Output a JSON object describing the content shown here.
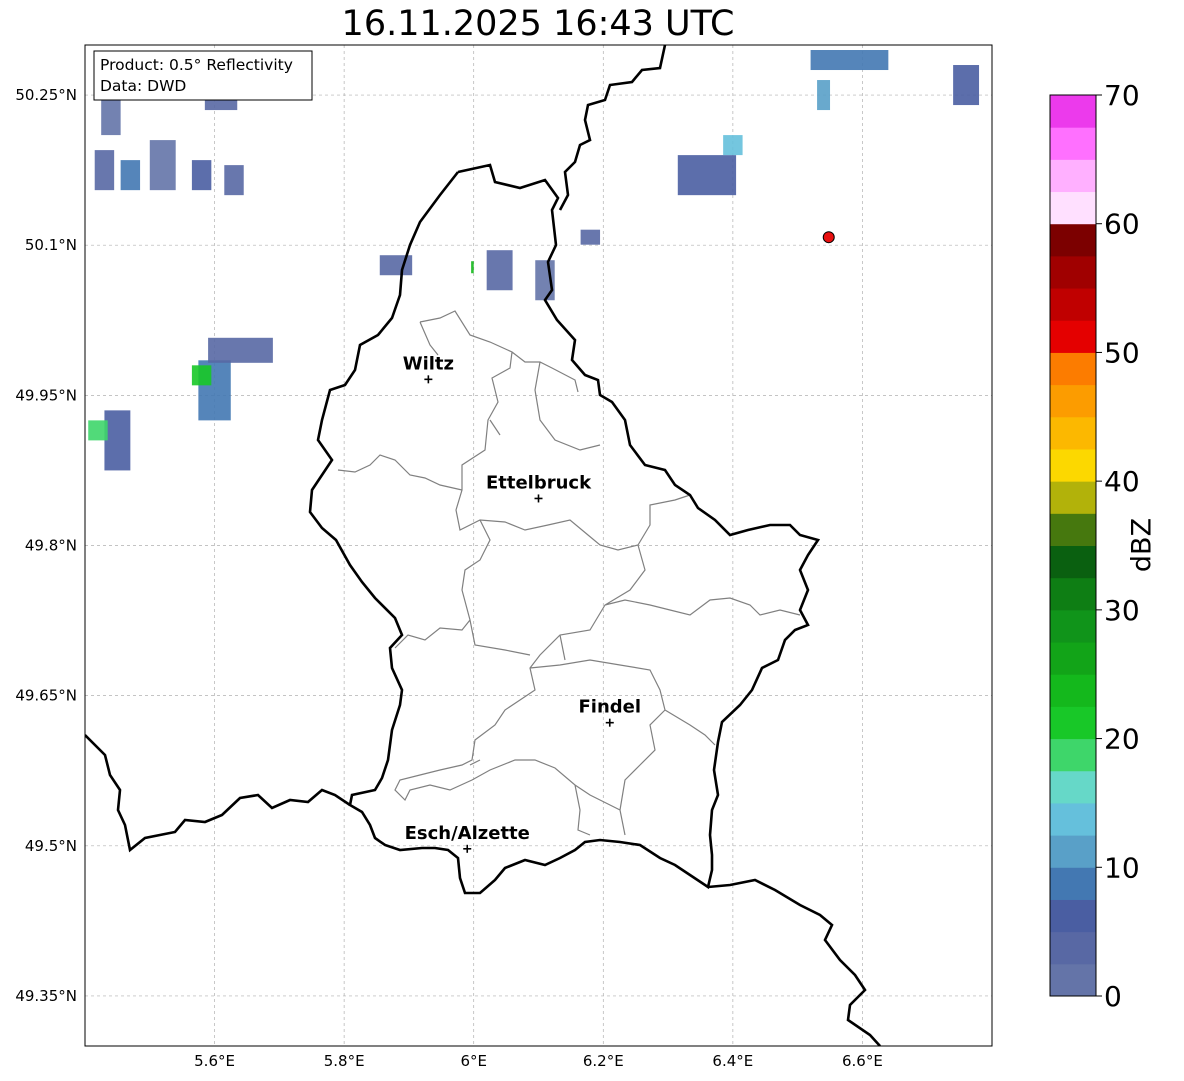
{
  "title": "16.11.2025 16:43 UTC",
  "info_box": {
    "product": "Product: 0.5° Reflectivity",
    "data": "Data: DWD"
  },
  "map": {
    "lon_range": [
      5.4,
      6.8
    ],
    "lat_range": [
      49.3,
      50.3
    ],
    "lon_ticks": [
      {
        "value": 5.6,
        "label": "5.6°E"
      },
      {
        "value": 5.8,
        "label": "5.8°E"
      },
      {
        "value": 6.0,
        "label": "6°E"
      },
      {
        "value": 6.2,
        "label": "6.2°E"
      },
      {
        "value": 6.4,
        "label": "6.4°E"
      },
      {
        "value": 6.6,
        "label": "6.6°E"
      }
    ],
    "lat_ticks": [
      {
        "value": 50.25,
        "label": "50.25°N"
      },
      {
        "value": 50.1,
        "label": "50.1°N"
      },
      {
        "value": 49.95,
        "label": "49.95°N"
      },
      {
        "value": 49.8,
        "label": "49.8°N"
      },
      {
        "value": 49.65,
        "label": "49.65°N"
      },
      {
        "value": 49.5,
        "label": "49.5°N"
      },
      {
        "value": 49.35,
        "label": "49.35°N"
      }
    ],
    "cities": [
      {
        "name": "Wiltz",
        "lon": 5.93,
        "lat": 49.966
      },
      {
        "name": "Ettelbruck",
        "lon": 6.1,
        "lat": 49.847
      },
      {
        "name": "Findel",
        "lon": 6.21,
        "lat": 49.623
      },
      {
        "name": "Esch/Alzette",
        "lon": 5.99,
        "lat": 49.497
      }
    ],
    "radar_site": {
      "lon": 6.548,
      "lat": 50.108,
      "color": "#e81010"
    },
    "echoes": [
      {
        "lon": 5.43,
        "lat": 50.175,
        "w": 0.03,
        "h": 0.04,
        "dbz": 3
      },
      {
        "lon": 5.47,
        "lat": 50.17,
        "w": 0.03,
        "h": 0.03,
        "dbz": 8
      },
      {
        "lon": 5.52,
        "lat": 50.18,
        "w": 0.04,
        "h": 0.05,
        "dbz": 2
      },
      {
        "lon": 5.58,
        "lat": 50.17,
        "w": 0.03,
        "h": 0.03,
        "dbz": 5
      },
      {
        "lon": 5.63,
        "lat": 50.165,
        "w": 0.03,
        "h": 0.03,
        "dbz": 3
      },
      {
        "lon": 5.61,
        "lat": 50.25,
        "w": 0.05,
        "h": 0.03,
        "dbz": 4
      },
      {
        "lon": 5.44,
        "lat": 50.24,
        "w": 0.03,
        "h": 0.06,
        "dbz": 2
      },
      {
        "lon": 5.6,
        "lat": 49.955,
        "w": 0.05,
        "h": 0.06,
        "dbz": 9
      },
      {
        "lon": 5.58,
        "lat": 49.97,
        "w": 0.03,
        "h": 0.02,
        "dbz": 22
      },
      {
        "lon": 5.64,
        "lat": 49.995,
        "w": 0.1,
        "h": 0.025,
        "dbz": 3
      },
      {
        "lon": 5.45,
        "lat": 49.905,
        "w": 0.04,
        "h": 0.06,
        "dbz": 7
      },
      {
        "lon": 5.42,
        "lat": 49.915,
        "w": 0.03,
        "h": 0.02,
        "dbz": 19
      },
      {
        "lon": 5.88,
        "lat": 50.08,
        "w": 0.05,
        "h": 0.02,
        "dbz": 3
      },
      {
        "lon": 6.04,
        "lat": 50.075,
        "w": 0.04,
        "h": 0.04,
        "dbz": 4
      },
      {
        "lon": 5.998,
        "lat": 50.078,
        "w": 0.004,
        "h": 0.012,
        "dbz": 24
      },
      {
        "lon": 6.11,
        "lat": 50.065,
        "w": 0.03,
        "h": 0.04,
        "dbz": 2
      },
      {
        "lon": 6.18,
        "lat": 50.108,
        "w": 0.03,
        "h": 0.015,
        "dbz": 3
      },
      {
        "lon": 6.36,
        "lat": 50.17,
        "w": 0.09,
        "h": 0.04,
        "dbz": 6
      },
      {
        "lon": 6.4,
        "lat": 50.2,
        "w": 0.03,
        "h": 0.02,
        "dbz": 14
      },
      {
        "lon": 6.58,
        "lat": 50.285,
        "w": 0.12,
        "h": 0.02,
        "dbz": 8
      },
      {
        "lon": 6.54,
        "lat": 50.25,
        "w": 0.02,
        "h": 0.03,
        "dbz": 12
      },
      {
        "lon": 6.76,
        "lat": 50.26,
        "w": 0.04,
        "h": 0.04,
        "dbz": 5
      }
    ],
    "colors": {
      "border": "#000000",
      "canton": "#808080",
      "grid": "#b0b0b0"
    }
  },
  "colorbar": {
    "label": "dBZ",
    "min": 0,
    "max": 70,
    "ticks": [
      {
        "value": 0,
        "label": "0"
      },
      {
        "value": 10,
        "label": "10"
      },
      {
        "value": 20,
        "label": "20"
      },
      {
        "value": 30,
        "label": "30"
      },
      {
        "value": 40,
        "label": "40"
      },
      {
        "value": 50,
        "label": "50"
      },
      {
        "value": 60,
        "label": "60"
      },
      {
        "value": 70,
        "label": "70"
      }
    ],
    "colors": [
      "#6474a8",
      "#5868a4",
      "#4a5ea2",
      "#4378b2",
      "#59a0c8",
      "#65c0dc",
      "#66d8c8",
      "#3ed66a",
      "#18c828",
      "#14b81c",
      "#12a418",
      "#10941a",
      "#0e7e14",
      "#0a6010",
      "#46780e",
      "#b2b20a",
      "#fcd800",
      "#fcb800",
      "#fc9c00",
      "#fc7c00",
      "#e40000",
      "#c00000",
      "#a00000",
      "#7c0000",
      "#ffe0ff",
      "#ffb0ff",
      "#ff70ff",
      "#ec3aec"
    ]
  }
}
